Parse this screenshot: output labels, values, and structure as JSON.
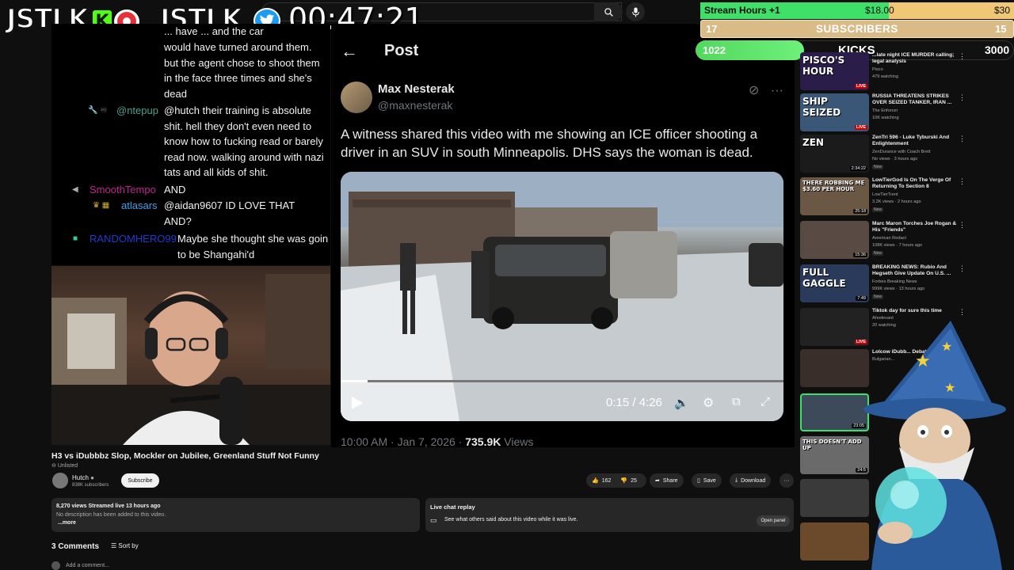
{
  "overlay": {
    "brand_left": "JSTLK",
    "brand_right": "JSTLK",
    "k_letter": "K",
    "timer": "00:47:21",
    "kick_icon": "kick-k-icon",
    "youtube_icon": "youtube-record-icon",
    "twitter_icon": "twitter-bird-icon"
  },
  "goals": {
    "stream_hours_label": "Stream Hours +1",
    "stream_hours_current": "$18.00",
    "stream_hours_goal": "$30",
    "stream_hours_progress": 0.6,
    "subs_left": "17",
    "subs_label": "SUBSCRIBERS",
    "subs_right": "15",
    "kicks_current": "1022",
    "kicks_label": "KICKS",
    "kicks_goal": "3000",
    "kicks_progress": 0.34,
    "colors": {
      "hours_fill": "#3fe06a",
      "hours_bg": "#f0c775",
      "subs_bg": "#d8bb86",
      "kicks_fill": "#53d85f"
    }
  },
  "chat": {
    "messages": [
      {
        "text": "... have ... and the car"
      },
      {
        "text": "would have turned around them."
      },
      {
        "text": "but the agent chose to shoot them"
      },
      {
        "text": "in the face three times and she's"
      },
      {
        "text": "dead"
      },
      {
        "user": "@ntepup",
        "user_color": "#4b9e8a",
        "text": "@hutch their training is absolute"
      },
      {
        "text": "shit. hell they don't even need to"
      },
      {
        "text": "know how to fucking read or barely"
      },
      {
        "text": "read now. walking around with nazi"
      },
      {
        "text": "tats and all kids of shit."
      },
      {
        "user": "SmoothTempo",
        "user_color": "#c3238f",
        "text": "AND"
      },
      {
        "user": "atlasars",
        "user_color": "#3aa0e8",
        "text": "@aidan9607 ID LOVE THAT"
      },
      {
        "text": "AND?"
      },
      {
        "user": "RANDOMHERO99",
        "user_color": "#1f3bd1",
        "text": "Maybe she thought she was goin"
      },
      {
        "text": "to be Shangahi'd"
      }
    ]
  },
  "tweet": {
    "header": "Post",
    "author_name": "Max Nesterak",
    "author_handle": "@maxnesterak",
    "body": "A witness shared this video with me showing an ICE officer shooting a driver in an SUV in south Minneapolis. DHS says the woman is dead.",
    "video_time": "0:15 / 4:26",
    "timestamp": "10:00 AM · Jan 7, 2026 · ",
    "views_count": "735.9K",
    "views_label": " Views",
    "video_progress": 0.06
  },
  "video_info": {
    "title": "H3 vs iDubbbz Slop, Mockler on Jubilee, Greenland Stuff Not Funny",
    "unlisted": "Unlisted",
    "channel": "Hutch",
    "subscribers": "838K subscribers",
    "subscribe_label": "Subscribe",
    "likes": "162",
    "dislikes": "25",
    "share_label": "Share",
    "save_label": "Save",
    "download_label": "Download",
    "description_stats": "8,270 views  Streamed live 13 hours ago",
    "description_text": "No description has been added to this video.",
    "more_label": "...more",
    "replay_title": "Live chat replay",
    "replay_desc": "See what others said about this video while it was live.",
    "open_panel": "Open panel",
    "comments_count": "3 Comments",
    "sort_by": "Sort by",
    "add_comment": "Add a comment..."
  },
  "sidebar": {
    "items": [
      {
        "title": "...late night ICE MURDER calling; legal analysis",
        "channel": "Pisco",
        "meta": "479 watching",
        "badge": "LIVE",
        "thumb_text": "PISCO'S HOUR",
        "thumb_bg": "#2b1d4a"
      },
      {
        "title": "RUSSIA THREATENS STRIKES OVER SEIZED TANKER, IRAN ...",
        "channel": "The Enforcer",
        "meta": "10K watching",
        "badge": "LIVE",
        "thumb_text": "SHIP SEIZED",
        "thumb_bg": "#3a5778"
      },
      {
        "title": "ZenTri 596 - Luke Tyburski And Enlightenment",
        "channel": "ZenDurance with Coach Brett",
        "meta": "No views · 3 hours ago",
        "badge": "2:34:22",
        "thumb_text": "ZEN",
        "thumb_bg": "#1b1b1b",
        "new": "New"
      },
      {
        "title": "LowTierGod Is On The Verge Of Returning To Section 8",
        "channel": "LowTierTrent",
        "meta": "3.2K views · 2 hours ago",
        "badge": "25:18",
        "thumb_text": "THERE ROBBING ME $3.60 PER HOUR",
        "thumb_bg": "#6b5844",
        "new": "New"
      },
      {
        "title": "Marc Maron Torches Joe Rogan & His \"Friends\"",
        "channel": "American Redact",
        "meta": "108K views · 7 hours ago",
        "badge": "15:36",
        "thumb_text": "",
        "thumb_bg": "#5a4a44",
        "new": "New"
      },
      {
        "title": "BREAKING NEWS: Rubio And Hegseth Give Update On U.S. ...",
        "channel": "Forbes Breaking News",
        "meta": "999K views · 13 hours ago",
        "badge": "7:49",
        "thumb_text": "FULL GAGGLE",
        "thumb_bg": "#2a3a5a",
        "new": "New"
      },
      {
        "title": "Tiktok day for sure this time",
        "channel": "Ahrelevant",
        "meta": "20 watching",
        "badge": "LIVE",
        "thumb_text": "",
        "thumb_bg": "#222",
        "new": ""
      },
      {
        "title": "Lolcow iDubb... Debate As...",
        "channel": "Bulgarian...",
        "meta": "",
        "badge": "",
        "thumb_text": "",
        "thumb_bg": "#3a2e2a",
        "new": ""
      },
      {
        "title": "",
        "channel": "",
        "meta": "",
        "badge": "23:05",
        "thumb_text": "",
        "thumb_bg": "#3d4a5a",
        "new": ""
      },
      {
        "title": "",
        "channel": "",
        "meta": "",
        "badge": "24:5",
        "thumb_text": "THIS DOESN'T ADD UP",
        "thumb_bg": "#6a6a6a",
        "new": ""
      },
      {
        "title": "",
        "channel": "",
        "meta": "",
        "badge": "",
        "thumb_text": "",
        "thumb_bg": "#3a3a3a",
        "new": ""
      },
      {
        "title": "",
        "channel": "",
        "meta": "",
        "badge": "",
        "thumb_text": "",
        "thumb_bg": "#6a4a2a",
        "new": ""
      }
    ]
  }
}
